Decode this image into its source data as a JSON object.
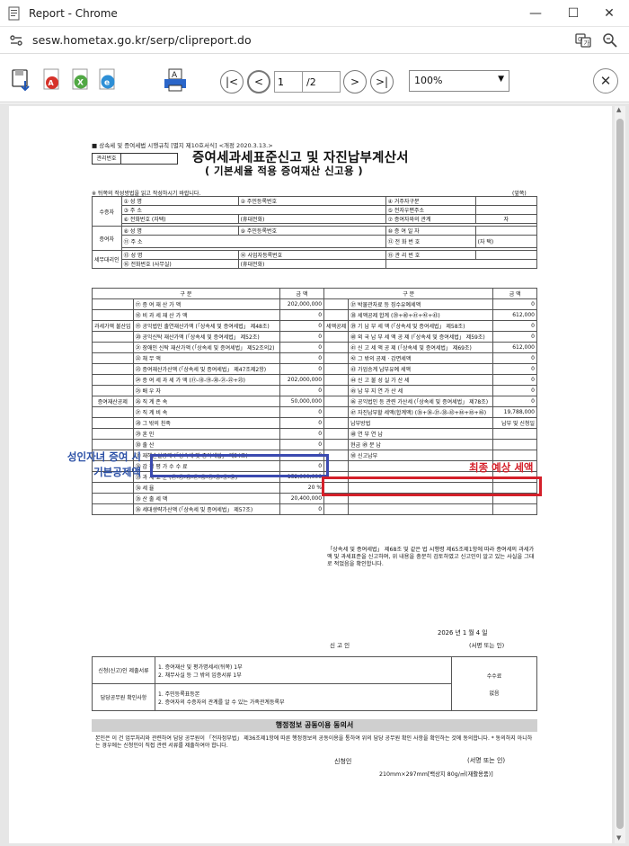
{
  "window": {
    "title": "Report - Chrome",
    "url": "sesw.hometax.go.kr/serp/clipreport.do"
  },
  "toolbar": {
    "page_current": "1",
    "page_total": "/2",
    "zoom": "100%"
  },
  "document": {
    "law_ref": "■ 상속세 및 증여세법 시행규칙 [별지 제10호서식] <개정 2020.3.13.>",
    "mgmt_label": "관리번호",
    "title": "증여세과세표준신고 및 자진납부계산서",
    "subtitle": "( 기본세율 적용 증여재산 신고용 )",
    "note": "※ 뒤쪽의 작성방법을 읽고 작성하시기 바랍니다.",
    "note_right": "(앞쪽)",
    "parties": {
      "recipient": "수증자",
      "donor": "증여자",
      "agent": "세무대리인",
      "name": "① 성 명",
      "rrn": "② 주민등록번호",
      "address": "③ 주 소",
      "phone": "⑥ 전화번호 (자택)",
      "mobile": "(휴대전화)",
      "email": "④ 거주자구분",
      "email2": "⑤ 전자우편주소",
      "relation": "⑦ 증여자와의 관계",
      "relation_value": "자",
      "donor_name": "⑧ 성 명",
      "donor_rrn": "⑨ 주민등록번호",
      "donor_date": "⑩ 증 여 일 자",
      "donor_addr": "⑪ 주 소",
      "donor_phone": "⑫ 전 화 번 호",
      "donor_phone_val": "(자 택)",
      "agent_name": "⑬ 성 명",
      "agent_biz": "⑭ 사업자등록번호",
      "agent_mgmt": "⑮ 관 리 번 호",
      "agent_phone": "⑯ 전화번호 (사무실)",
      "agent_mobile": "(휴대전화)"
    },
    "calc_header": {
      "item": "구 분",
      "amount": "금 액"
    },
    "left_rows": [
      {
        "label": "⑰ 증 여 재 산 가 액",
        "value": "202,000,000"
      },
      {
        "label": "⑱ 비 과 세 재 산 가 액",
        "value": "0"
      },
      {
        "label": "⑲ 공익법인 출연재산가액 (「상속세 및 증여세법」 제48조)",
        "value": "0"
      },
      {
        "label": "⑳ 공익신탁 재산가액 (「상속세 및 증여세법」 제52조)",
        "value": "0"
      },
      {
        "label": "㉑ 장애인 신탁 재산가액 (「상속세 및 증여세법」 제52조의2)",
        "value": "0"
      },
      {
        "label": "㉒ 채 무 액",
        "value": "0"
      },
      {
        "label": "㉓ 증여재산가산액 (「상속세 및 증여세법」 제47조제2항)",
        "value": "0"
      },
      {
        "label": "㉔ 증 여 세 과 세 가 액 (⑰-⑱-⑲-⑳-㉑-㉒+㉓)",
        "value": "202,000,000"
      },
      {
        "label": "㉕ 배 우 자",
        "value": "0"
      },
      {
        "label": "㉖ 직 계 존 속",
        "value": "50,000,000"
      },
      {
        "label": "㉗ 직 계 비 속",
        "value": "0"
      },
      {
        "label": "㉘ 그 밖의 친족",
        "value": "0"
      },
      {
        "label": "㉙ 혼 인",
        "value": "0"
      },
      {
        "label": "㉚ 출 산",
        "value": "0"
      },
      {
        "label": "㉛ 재해손실공제 (「상속세 및 증여세법」 제54조)",
        "value": "0"
      },
      {
        "label": "㉜ 감 정 평 가 수 수 료",
        "value": "0"
      },
      {
        "label": "㉝ 과 세 표 준 (㉔-㉕-㉖-㉗-㉘-㉙-㉚-㉛-㉜)",
        "value": "152,000,000"
      },
      {
        "label": "㉞ 세 율",
        "value": "20 %"
      },
      {
        "label": "㉟ 산 출 세 액",
        "value": "20,400,000"
      },
      {
        "label": "㊱ 세대생략가산액 (「상속세 및 증여세법」 제57조)",
        "value": "0"
      }
    ],
    "deduction_section": "증여재산공제",
    "sec_left": "과세가액 불산입",
    "right_rows": [
      {
        "label": "㊲ 박물관자료 등 징수유예세액",
        "value": "0"
      },
      {
        "label": "㊳ 세액공제 합계 (㊴+㊵+㊶+㊷+㊸)",
        "value": "612,000"
      },
      {
        "label": "㊴ 기 납 부 세 액 (「상속세 및 증여세법」 제58조)",
        "value": "0"
      },
      {
        "label": "㊵ 외 국 납 부 세 액 공 제 (「상속세 및 증여세법」 제59조)",
        "value": "0"
      },
      {
        "label": "㊶ 신 고 세 액 공 제 (「상속세 및 증여세법」 제69조)",
        "value": "612,000"
      },
      {
        "label": "㊷ 그 밖의 공제 · 감면세액",
        "value": "0"
      },
      {
        "label": "㊸ 가업승계 납부유예 세액",
        "value": "0"
      },
      {
        "label": "㊹ 신 고 불 성 실 가 산 세",
        "value": "0"
      },
      {
        "label": "㊺ 납 부 지 연 가 산 세",
        "value": "0"
      },
      {
        "label": "㊻ 공익법인 등 관련 가산세 (「상속세 및 증여세법」 제78조)",
        "value": "0"
      },
      {
        "label": "㊼ 자진납부할 세액(합계액) (㉟+㊱-㊲-㊳-㊸+㊹+㊺+㊻)",
        "value": "19,788,000"
      },
      {
        "label": "납부방법",
        "value": "납부 및 신청일"
      },
      {
        "label": "㊽ 연 부 연 납",
        "value": ""
      },
      {
        "label": "현금  ㊾ 분 납",
        "value": ""
      },
      {
        "label": "㊿ 신고납부",
        "value": ""
      }
    ],
    "sec_right": "세액공제",
    "declaration": "「상속세 및 증여세법」 제68조 및 같은 법 시행령 제65조제1항에 따라 증여세의 과세가액 및 과세표준을 신고하며, 위 내용을 충분히 검토하였고 신고인이 알고 있는 사실을 그대로 적었음을 확인합니다.",
    "decl_date": "2026 년 1 월 4 일",
    "decl_who": "신 고 인",
    "decl_sign": "(서명 또는 인)",
    "attach": {
      "submit_label": "신청(신고)인 제출서류",
      "submit_items": "1. 증여재산 및 평가명세서(뒤쪽) 1부\n2. 채무사실 등 그 밖의 입증서류 1부",
      "check_label": "담당공무원 확인사항",
      "check_items": "1. 주민등록표등본\n2. 증여자의 수증자의 관계를 알 수 있는 가족관계등록부",
      "fee_label": "수수료",
      "fee_value": "없음"
    },
    "consent_title": "행정정보 공동이용 동의서",
    "consent_body": "본인은 이 건 업무처리와 관련하여 담당 공무원이 「전자정부법」 제36조제1항에 따른 행정정보의 공동이용을 통하여 위의 담당 공무원 확인 사항을 확인하는 것에 동의합니다. * 동의하지 아니하는 경우에는 신청인이 직접 관련 서류를 제출하여야 합니다.",
    "applicant": "신청인",
    "applicant_sign": "(서명 또는 인)",
    "paper_size": "210mm×297mm[백상지 80g/㎡(재활용품)]"
  },
  "annotations": {
    "blue_label": "성인자녀 증여 시 기본공제액",
    "red_label": "최종 예상 세액",
    "blue_color": "#3b4ab0",
    "red_color": "#d4202a"
  }
}
